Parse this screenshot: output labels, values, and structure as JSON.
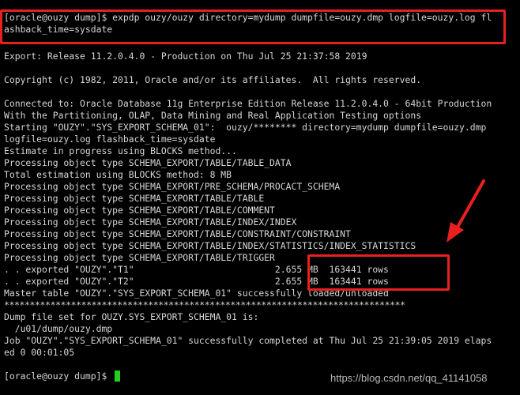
{
  "terminal": {
    "prompt": "[oracle@ouzy dump]$",
    "command_line1": "[oracle@ouzy dump]$ expdp ouzy/ouzy directory=mydump dumpfile=ouzy.dmp logfile=ouzy.log fl",
    "command_line2": "ashback_time=sysdate",
    "release": "Export: Release 11.2.0.4.0 - Production on Thu Jul 25 21:37:58 2019",
    "copyright": "Copyright (c) 1982, 2011, Oracle and/or its affiliates.  All rights reserved.",
    "connected1": "Connected to: Oracle Database 11g Enterprise Edition Release 11.2.0.4.0 - 64bit Production",
    "connected2": "With the Partitioning, OLAP, Data Mining and Real Application Testing options",
    "starting1": "Starting \"OUZY\".\"SYS_EXPORT_SCHEMA_01\":  ouzy/******** directory=mydump dumpfile=ouzy.dmp",
    "starting2": "logfile=ouzy.log flashback_time=sysdate",
    "estimate": "Estimate in progress using BLOCKS method...",
    "proc_table_data": "Processing object type SCHEMA_EXPORT/TABLE/TABLE_DATA",
    "total_estimation": "Total estimation using BLOCKS method: 8 MB",
    "proc_procact": "Processing object type SCHEMA_EXPORT/PRE_SCHEMA/PROCACT_SCHEMA",
    "proc_table": "Processing object type SCHEMA_EXPORT/TABLE/TABLE",
    "proc_comment": "Processing object type SCHEMA_EXPORT/TABLE/COMMENT",
    "proc_index": "Processing object type SCHEMA_EXPORT/TABLE/INDEX/INDEX",
    "proc_constraint": "Processing object type SCHEMA_EXPORT/TABLE/CONSTRAINT/CONSTRAINT",
    "proc_index_stats": "Processing object type SCHEMA_EXPORT/TABLE/INDEX/STATISTICS/INDEX_STATISTICS",
    "proc_trigger": "Processing object type SCHEMA_EXPORT/TABLE/TRIGGER",
    "exported_t1": ". . exported \"OUZY\".\"T1\"                          2.655 MB  163441 rows",
    "exported_t2": ". . exported \"OUZY\".\"T2\"                          2.655 MB  163441 rows",
    "master_table": "Master table \"OUZY\".\"SYS_EXPORT_SCHEMA_01\" successfully loaded/unloaded",
    "separator": "******************************************************************************",
    "dump_file_set": "Dump file set for OUZY.SYS_EXPORT_SCHEMA_01 is:",
    "dump_file_path": "  /u01/dump/ouzy.dmp",
    "job_completed1": "Job \"OUZY\".\"SYS_EXPORT_SCHEMA_01\" successfully completed at Thu Jul 25 21:39:05 2019 elaps",
    "job_completed2": "ed 0 00:01:05",
    "final_prompt": "[oracle@ouzy dump]$"
  },
  "annotations": {
    "highlight_color": "#e8201e",
    "cursor_color": "#20d020"
  },
  "watermark": "https://blog.csdn.net/qq_41141058"
}
